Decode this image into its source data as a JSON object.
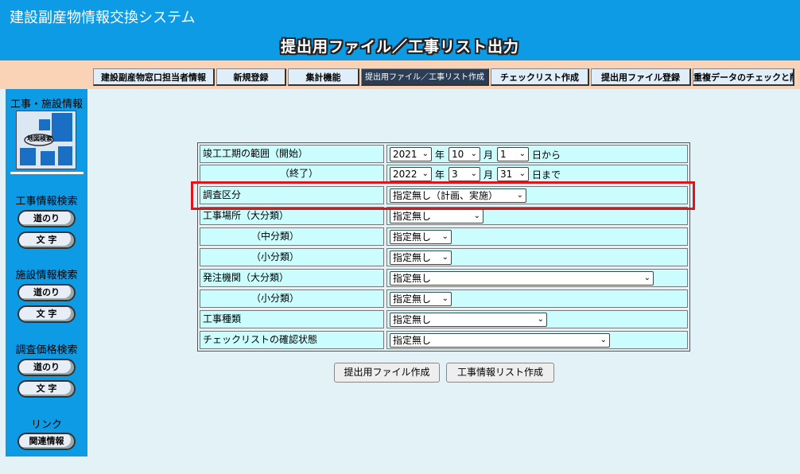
{
  "app_title": "建設副産物情報交換システム",
  "page_title": "提出用ファイル／工事リスト出力",
  "tabs": [
    {
      "label": "建設副産物窓口担当者情報"
    },
    {
      "label": "新規登録"
    },
    {
      "label": "集計機能"
    },
    {
      "label": "提出用ファイル／工事リスト作成"
    },
    {
      "label": "チェックリスト作成"
    },
    {
      "label": "提出用ファイル登録"
    },
    {
      "label": "重複データのチェックと削除"
    }
  ],
  "sidebar": {
    "section_construction_facility": "工事・施設情報",
    "map_button": "地図検索",
    "construction_search": "工事情報検索",
    "facility_search": "施設情報検索",
    "price_search": "調査価格検索",
    "route_label": "道のり",
    "text_label": "文 字",
    "link_label": "リンク",
    "related_info": "関連情報"
  },
  "form": {
    "completion_start_label": "竣工工期の範囲（開始）",
    "completion_end_label": "（終了）",
    "start_year": "2021",
    "start_month": "10",
    "start_day": "1",
    "end_year": "2022",
    "end_month": "3",
    "end_day": "31",
    "year_unit": "年",
    "month_unit": "月",
    "from_unit": "日から",
    "until_unit": "日まで",
    "survey_label": "調査区分",
    "survey_value": "指定無し（計画、実施）",
    "site_major_label": "工事場所（大分類）",
    "site_major_value": "指定無し",
    "site_middle_label": "（中分類）",
    "site_middle_value": "指定無し",
    "site_minor_label": "（小分類）",
    "site_minor_value": "指定無し",
    "orderer_major_label": "発注機関（大分類）",
    "orderer_major_value": "指定無し",
    "orderer_minor_label": "（小分類）",
    "orderer_minor_value": "指定無し",
    "work_type_label": "工事種類",
    "work_type_value": "指定無し",
    "checklist_status_label": "チェックリストの確認状態",
    "checklist_status_value": "指定無し"
  },
  "buttons": {
    "create_submission": "提出用ファイル作成",
    "create_list": "工事情報リスト作成"
  },
  "colors": {
    "header_blue": "#0d9be6",
    "tabbar_peach": "#fad3b6",
    "cell_cyan": "#ccfdfe",
    "highlight_red": "#e0141b"
  }
}
